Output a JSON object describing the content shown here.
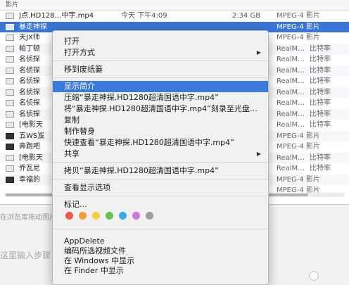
{
  "finder": {
    "section_title": "影片",
    "rows": [
      {
        "name": "J点.HD128…中字.mp4",
        "date": "今天 下午4:09",
        "size": "2.34 GB",
        "kind": "MPEG-4 影片",
        "extra": "",
        "icon": "light",
        "selected": false
      },
      {
        "name": "暴走神探",
        "date": "",
        "size": "",
        "kind": "MPEG-4 影片",
        "extra": "",
        "icon": "sel",
        "selected": true
      },
      {
        "name": "天JX师",
        "date": "",
        "size": "",
        "kind": "MPEG-4 影片",
        "extra": "",
        "icon": "light",
        "selected": false
      },
      {
        "name": "帕丁顿",
        "date": "",
        "size": "",
        "kind": "RealM…",
        "extra": "比特率",
        "icon": "light",
        "selected": false
      },
      {
        "name": "名侦探",
        "date": "",
        "size": "",
        "kind": "RealM…",
        "extra": "比特率",
        "icon": "light",
        "selected": false
      },
      {
        "name": "名侦探",
        "date": "",
        "size": "",
        "kind": "RealM…",
        "extra": "比特率",
        "icon": "light",
        "selected": false
      },
      {
        "name": "名侦探",
        "date": "",
        "size": "",
        "kind": "RealM…",
        "extra": "比特率",
        "icon": "light",
        "selected": false
      },
      {
        "name": "名侦探",
        "date": "",
        "size": "",
        "kind": "RealM…",
        "extra": "比特率",
        "icon": "light",
        "selected": false
      },
      {
        "name": "名侦探",
        "date": "",
        "size": "",
        "kind": "RealM…",
        "extra": "比特率",
        "icon": "light",
        "selected": false
      },
      {
        "name": "名侦探",
        "date": "",
        "size": "",
        "kind": "RealM…",
        "extra": "比特率",
        "icon": "light",
        "selected": false
      },
      {
        "name": "[电影天",
        "date": "",
        "size": "",
        "kind": "RealM…",
        "extra": "比特率",
        "icon": "light",
        "selected": false
      },
      {
        "name": "五WS岌",
        "date": "",
        "size": "",
        "kind": "MPEG-4 影片",
        "extra": "",
        "icon": "dark",
        "selected": false
      },
      {
        "name": "奔跑吧",
        "date": "",
        "size": "",
        "kind": "MPEG-4 影片",
        "extra": "",
        "icon": "dark",
        "selected": false
      },
      {
        "name": "[电影天",
        "date": "",
        "size": "",
        "kind": "RealM…",
        "extra": "比特率",
        "icon": "light",
        "selected": false
      },
      {
        "name": "乔瓦尼",
        "date": "",
        "size": "",
        "kind": "RealM…",
        "extra": "比特率",
        "icon": "light",
        "selected": false
      },
      {
        "name": "幸福的",
        "date": "",
        "size": "",
        "kind": "MPEG-4 影片",
        "extra": "",
        "icon": "dark",
        "selected": false
      },
      {
        "name": "",
        "date": "",
        "size": "",
        "kind": "MPEG-4 影片",
        "extra": "",
        "icon": "none",
        "selected": false
      }
    ],
    "status_text": "在浏览库拖动图片",
    "prompt_text": "这里输入步骤"
  },
  "menu": {
    "items": [
      {
        "label": "打开",
        "submenu": false,
        "highlight": false,
        "sep_before": false
      },
      {
        "label": "打开方式",
        "submenu": true,
        "highlight": false,
        "sep_before": false
      },
      {
        "label": "移到废纸篓",
        "submenu": false,
        "highlight": false,
        "sep_before": true
      },
      {
        "label": "显示简介",
        "submenu": false,
        "highlight": true,
        "sep_before": true
      },
      {
        "label": "压缩“暴走神探.HD1280超清国语中字.mp4”",
        "submenu": false,
        "highlight": false,
        "sep_before": false
      },
      {
        "label": "将“暴走神探.HD1280超清国语中字.mp4”刻录至光盘…",
        "submenu": false,
        "highlight": false,
        "sep_before": false
      },
      {
        "label": "复制",
        "submenu": false,
        "highlight": false,
        "sep_before": false
      },
      {
        "label": "制作替身",
        "submenu": false,
        "highlight": false,
        "sep_before": false
      },
      {
        "label": "快速查看“暴走神探.HD1280超清国语中字.mp4”",
        "submenu": false,
        "highlight": false,
        "sep_before": false
      },
      {
        "label": "共享",
        "submenu": true,
        "highlight": false,
        "sep_before": false
      },
      {
        "label": "拷贝“暴走神探.HD1280超清国语中字.mp4”",
        "submenu": false,
        "highlight": false,
        "sep_before": true
      },
      {
        "label": "查看显示选项",
        "submenu": false,
        "highlight": false,
        "sep_before": true
      },
      {
        "label": "标记…",
        "submenu": false,
        "highlight": false,
        "sep_before": true
      }
    ],
    "tag_colors": [
      "#f0564a",
      "#f5a030",
      "#f5cf33",
      "#63c64a",
      "#35aaf0",
      "#c879d9",
      "#9d9d9d"
    ],
    "service_items": [
      "AppDelete",
      "编码所选视频文件",
      "在 Windows 中显示",
      "在 Finder 中显示"
    ],
    "submenu_arrow": "▶"
  }
}
